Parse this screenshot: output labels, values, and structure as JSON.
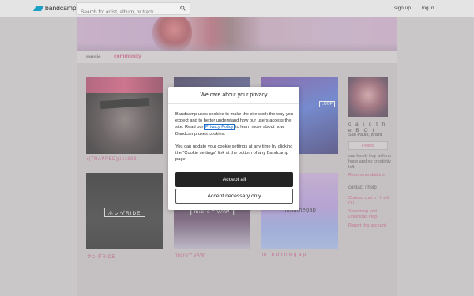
{
  "header": {
    "logo_text": "bandcamp",
    "search_placeholder": "Search for artist, album, or track",
    "signup_label": "sign up",
    "login_label": "log in"
  },
  "tabs": {
    "music_label": "music",
    "community_label": "community"
  },
  "releases": [
    {
      "title": "((TRAPPED))in1993"
    },
    {
      "title": ""
    },
    {
      "title": ""
    },
    {
      "title": "ホンダRIDE",
      "cover_text": "ホンダRIDE"
    },
    {
      "title": "micro℠VAW",
      "cover_text": "micro℠VAW"
    },
    {
      "title": "m i n d t h e g a p",
      "cover_text": "mindthegap"
    }
  ],
  "cover_tags": {
    "c3_tag": "LOOP"
  },
  "artist": {
    "name": "c a i o t h e B O I",
    "location": "São Paulo, Brazil",
    "follow_label": "Follow",
    "bio": "sad lonely boy with no hope and no creativity left.",
    "recommendations_label": "Recommendations",
    "contact_heading": "contact / help",
    "contact_link": "Contact c a i o t h e B O I",
    "streaming_link": "Streaming and Download help",
    "report_link": "Report this account"
  },
  "cookie_modal": {
    "title": "We care about your privacy",
    "p1_before": "Bandcamp uses cookies to make the site work the way you expect and to better understand how our users access the site. Read our ",
    "p1_link": "Privacy Policy",
    "p1_after": " to learn more about how Bandcamp uses cookies.",
    "p2": "You can update your cookie settings at any time by clicking the “Cookie settings” link at the bottom of any Bandcamp page.",
    "accept_all_label": "Accept all",
    "accept_necessary_label": "Accept necessary only"
  },
  "colors": {
    "accent": "#c24a7c",
    "logo": "#1da0c3",
    "primary_button": "#242424"
  }
}
